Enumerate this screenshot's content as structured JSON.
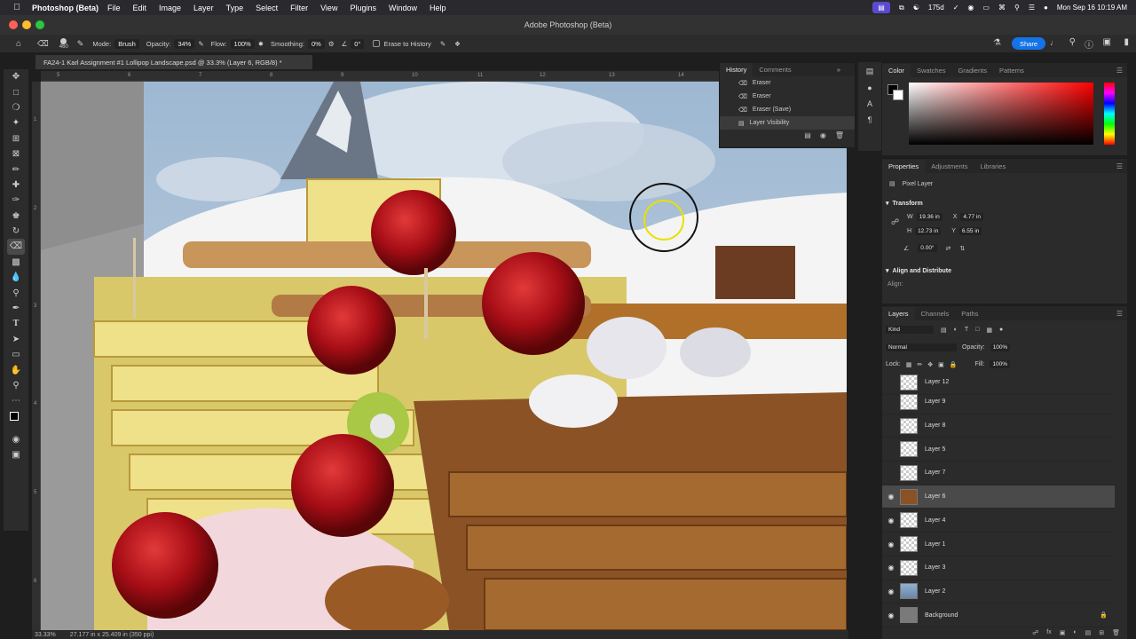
{
  "menubar": {
    "app_name": "Photoshop (Beta)",
    "items": [
      "File",
      "Edit",
      "Image",
      "Layer",
      "Type",
      "Select",
      "Filter",
      "View",
      "Plugins",
      "Window",
      "Help"
    ],
    "temperature": "175d",
    "datetime": "Mon Sep 16  10:19 AM"
  },
  "window": {
    "title": "Adobe Photoshop (Beta)"
  },
  "options_bar": {
    "brush_size": "460",
    "mode_label": "Mode:",
    "mode_value": "Brush",
    "opacity_label": "Opacity:",
    "opacity_value": "34%",
    "flow_label": "Flow:",
    "flow_value": "100%",
    "smoothing_label": "Smoothing:",
    "smoothing_value": "0%",
    "angle_value": "0°",
    "erase_history_label": "Erase to History",
    "share_label": "Share"
  },
  "document": {
    "tab_title": "FA24-1 Karl Assignment #1 Lollipop Landscape.psd @ 33.3% (Layer 6, RGB/8) *",
    "zoom": "33.33%",
    "dimensions": "27.177 in x 25.409 in (350 ppi)",
    "ruler_top": [
      "5",
      "6",
      "7",
      "8",
      "9",
      "10",
      "11",
      "12",
      "13",
      "14"
    ],
    "ruler_left": [
      "1",
      "2",
      "3",
      "4",
      "5",
      "6"
    ]
  },
  "history": {
    "tabs": [
      "History",
      "Comments"
    ],
    "items": [
      "Eraser",
      "Eraser",
      "Eraser (Save)",
      "Layer Visibility"
    ],
    "selected_index": 3
  },
  "color_panel": {
    "tabs": [
      "Color",
      "Swatches",
      "Gradients",
      "Patterns"
    ],
    "hue_color": "#ff0000"
  },
  "properties": {
    "tabs": [
      "Properties",
      "Adjustments",
      "Libraries"
    ],
    "kind": "Pixel Layer",
    "transform_label": "Transform",
    "w": "19.36 in",
    "h": "12.73 in",
    "x": "4.77 in",
    "y": "6.55 in",
    "angle": "0.00°",
    "align_section": "Align and Distribute",
    "align_label": "Align:",
    "w_label": "W",
    "h_label": "H",
    "x_label": "X",
    "y_label": "Y"
  },
  "layers_panel": {
    "tabs": [
      "Layers",
      "Channels",
      "Paths"
    ],
    "filter": "Kind",
    "blend_mode": "Normal",
    "opacity_label": "Opacity:",
    "opacity": "100%",
    "lock_label": "Lock:",
    "fill_label": "Fill:",
    "fill": "100%",
    "layers": [
      {
        "name": "Layer 12",
        "visible": false
      },
      {
        "name": "Layer 9",
        "visible": false
      },
      {
        "name": "Layer 8",
        "visible": false
      },
      {
        "name": "Layer 5",
        "visible": false
      },
      {
        "name": "Layer 7",
        "visible": false
      },
      {
        "name": "Layer 6",
        "visible": true,
        "selected": true
      },
      {
        "name": "Layer 4",
        "visible": true
      },
      {
        "name": "Layer 1",
        "visible": true
      },
      {
        "name": "Layer 3",
        "visible": true
      },
      {
        "name": "Layer 2",
        "visible": true
      },
      {
        "name": "Background",
        "visible": true,
        "locked": true
      }
    ]
  },
  "icons": {
    "toolbar": [
      "move-icon",
      "marquee-icon",
      "lasso-icon",
      "magic-wand-icon",
      "crop-icon",
      "frame-icon",
      "eyedropper-icon",
      "healing-brush-icon",
      "brush-icon",
      "clone-stamp-icon",
      "history-brush-icon",
      "eraser-icon",
      "gradient-icon",
      "blur-icon",
      "dodge-icon",
      "pen-icon",
      "type-icon",
      "path-selection-icon",
      "rectangle-icon",
      "hand-icon",
      "zoom-icon",
      "more-tools-icon",
      "colors-icon",
      "quick-mask-icon",
      "screen-mode-icon"
    ]
  }
}
